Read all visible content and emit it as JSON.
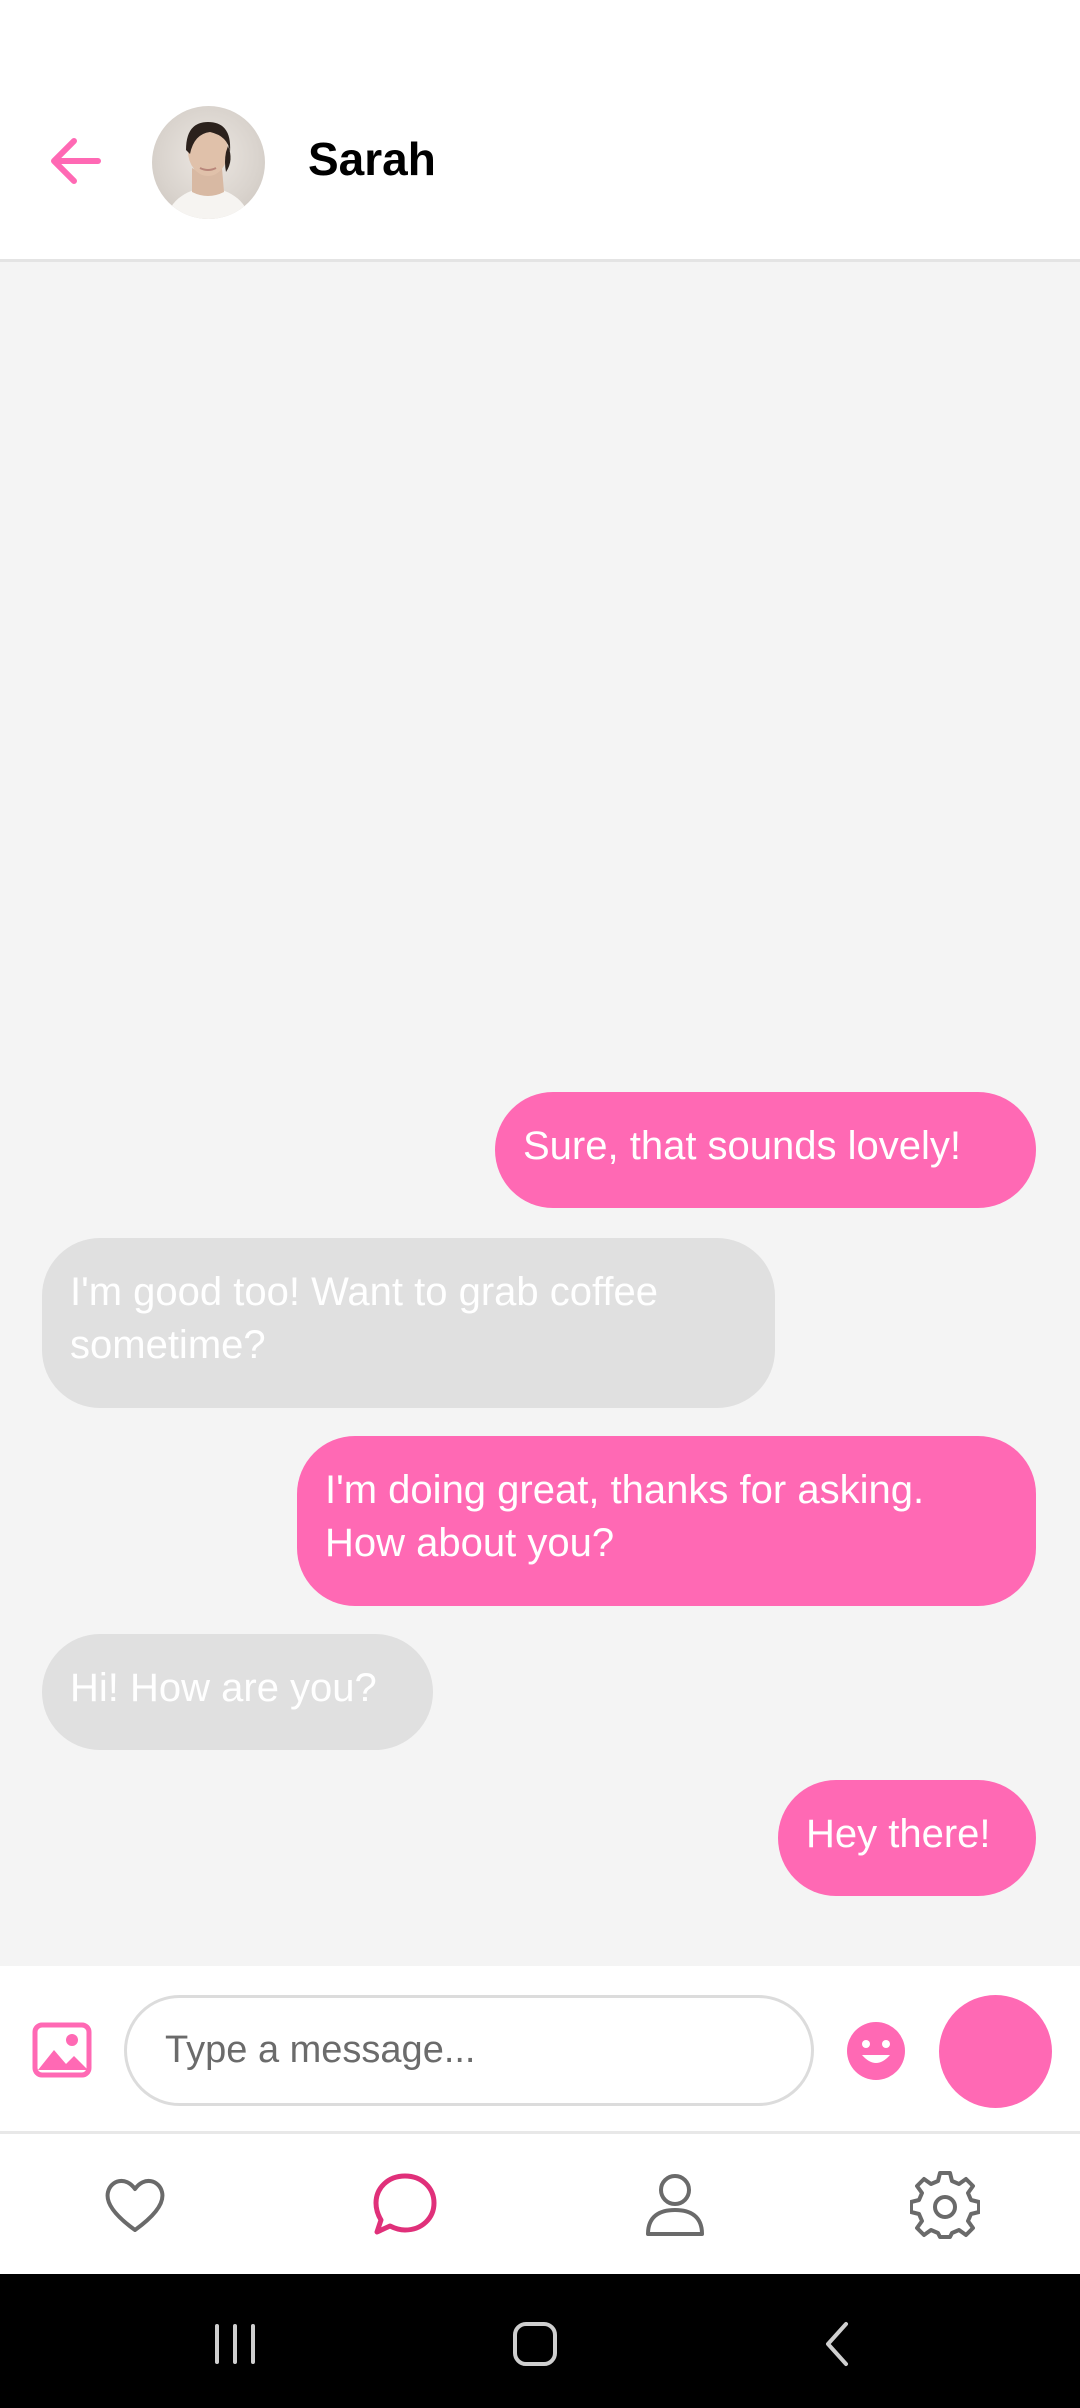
{
  "header": {
    "contact_name": "Sarah",
    "back_icon": "arrow-left-icon",
    "accent_color": "#ff69b4"
  },
  "messages": [
    {
      "from": "me",
      "text": "Sure, that sounds lovely!"
    },
    {
      "from": "Sarah",
      "text": "I'm good too! Want to grab coffee sometime?"
    },
    {
      "from": "me",
      "text": "I'm doing great, thanks for asking. How about you?"
    },
    {
      "from": "Sarah",
      "text": "Hi! How are you?"
    },
    {
      "from": "me",
      "text": "Hey there!"
    }
  ],
  "composer": {
    "placeholder": "Type a message...",
    "value": "",
    "image_icon": "image-icon",
    "emoji_icon": "emoji-icon"
  },
  "bottom_nav": {
    "items": [
      {
        "name": "likes",
        "icon": "heart-icon",
        "active": false
      },
      {
        "name": "chats",
        "icon": "chat-bubble-icon",
        "active": true
      },
      {
        "name": "profile",
        "icon": "person-icon",
        "active": false
      },
      {
        "name": "settings",
        "icon": "gear-icon",
        "active": false
      }
    ],
    "active_color": "#e0307a"
  },
  "colors": {
    "sent_bubble": "#ff69b4",
    "received_bubble": "#e0e0e0",
    "chat_background": "#f4f4f4"
  }
}
